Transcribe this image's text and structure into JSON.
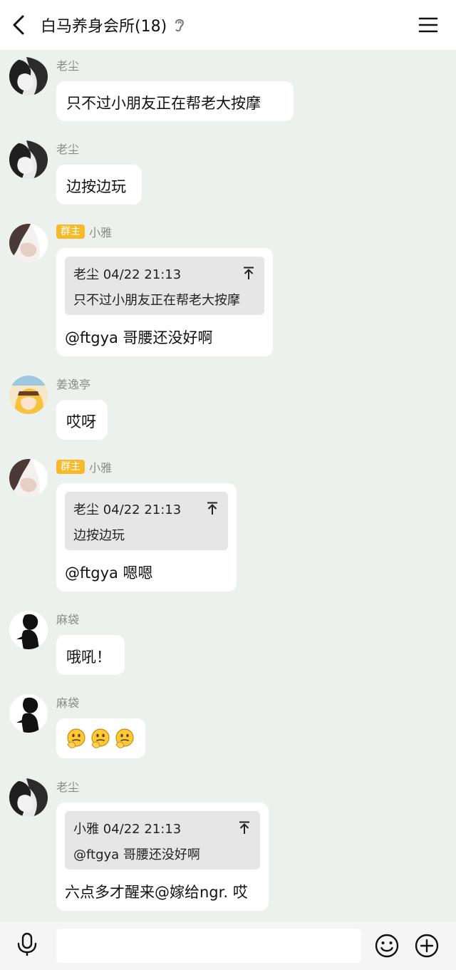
{
  "header": {
    "title": "白马养身会所(18)"
  },
  "messages": [
    {
      "sender": "老尘",
      "text": "只不过小朋友正在帮老大按摩"
    },
    {
      "sender": "老尘",
      "text": "边按边玩"
    },
    {
      "badge": "群主",
      "sender": "小雅",
      "quote": {
        "author": "老尘 04/22 21:13",
        "text": "只不过小朋友正在帮老大按摩"
      },
      "text": "@ftgya 哥腰还没好啊"
    },
    {
      "sender": "姜逸亭",
      "text": "哎呀"
    },
    {
      "badge": "群主",
      "sender": "小雅",
      "quote": {
        "author": "老尘 04/22 21:13",
        "text": "边按边玩"
      },
      "text": "@ftgya 嗯嗯"
    },
    {
      "sender": "麻袋",
      "text": "哦吼！"
    },
    {
      "sender": "麻袋",
      "stickers": [
        "thinking-face-emoji",
        "thinking-face-emoji",
        "thinking-face-emoji"
      ]
    },
    {
      "sender": "老尘",
      "quote": {
        "author": "小雅 04/22 21:13",
        "text": "@ftgya 哥腰还没好啊"
      },
      "text": "六点多才醒来@嫁给ngr. 哎"
    }
  ],
  "input": {
    "value": ""
  }
}
